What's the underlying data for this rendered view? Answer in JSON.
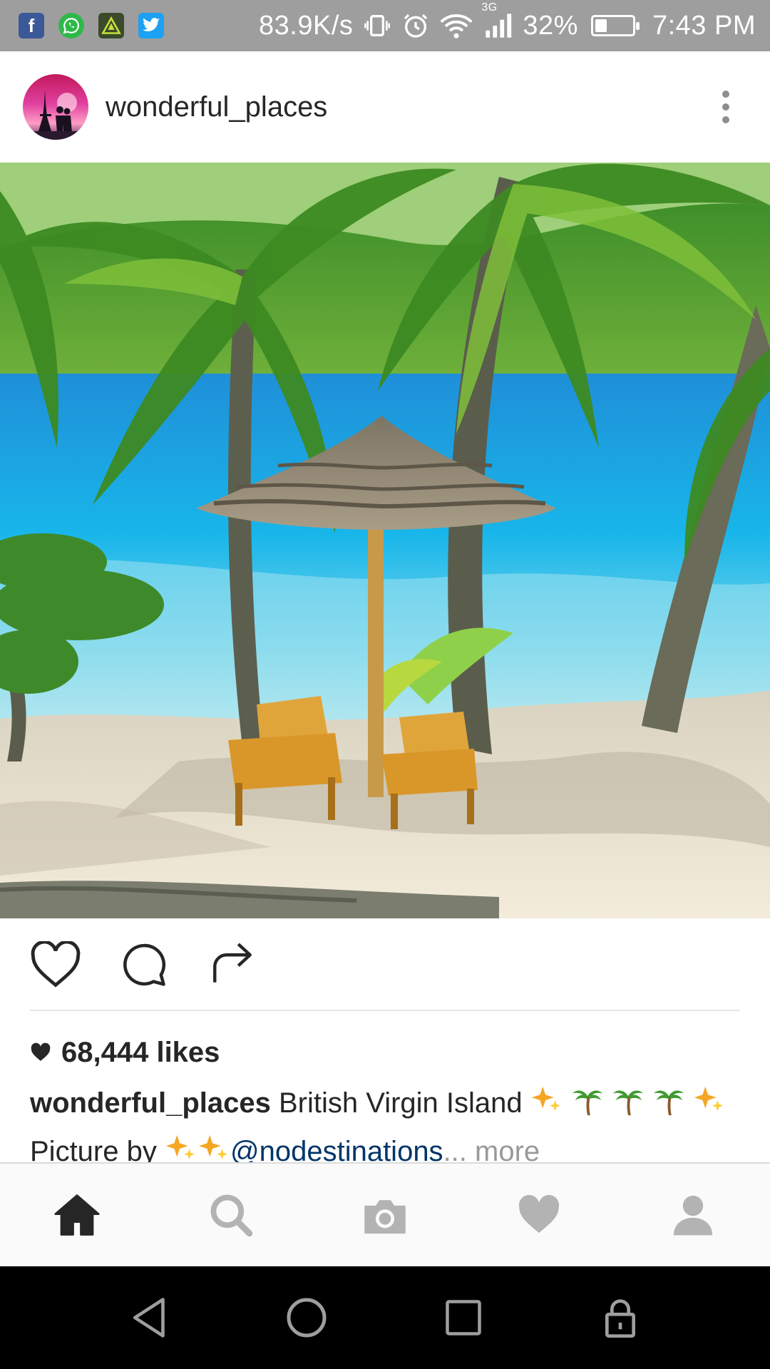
{
  "status_bar": {
    "notification_icons": [
      "facebook-icon",
      "whatsapp-icon",
      "android-app-icon",
      "twitter-icon"
    ],
    "network_speed": "83.9K/s",
    "network_type": "3G",
    "battery_percent": "32%",
    "battery_level": 0.32,
    "time": "7:43 PM"
  },
  "post": {
    "username": "wonderful_places",
    "likes_text": "68,444 likes",
    "caption": {
      "username": "wonderful_places",
      "text": "British Virgin Island",
      "line2_prefix": "Picture by",
      "mention": "@nodestinations",
      "ellipsis": "...",
      "more": "more"
    }
  },
  "tabs": [
    "home-icon",
    "search-icon",
    "camera-icon",
    "heart-icon",
    "profile-icon"
  ],
  "colors": {
    "status_bar": "#9e9e9e",
    "mention": "#003569",
    "muted": "#999999",
    "text": "#262626",
    "nav_bar": "#000000"
  }
}
